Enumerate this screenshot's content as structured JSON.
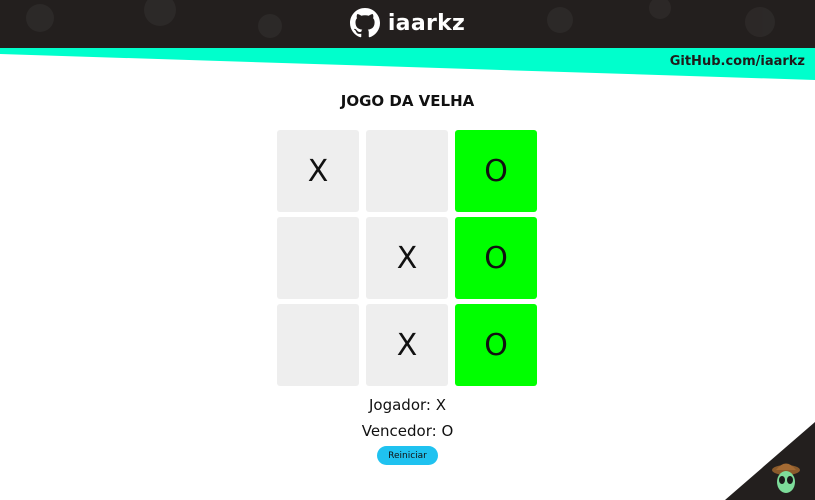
{
  "header": {
    "brand_name": "iaarkz",
    "github_link": "GitHub.com/iaarkz"
  },
  "game": {
    "title": "JOGO DA VELHA",
    "board": [
      {
        "value": "X",
        "winning": false
      },
      {
        "value": "",
        "winning": false
      },
      {
        "value": "O",
        "winning": true
      },
      {
        "value": "",
        "winning": false
      },
      {
        "value": "X",
        "winning": false
      },
      {
        "value": "O",
        "winning": true
      },
      {
        "value": "",
        "winning": false
      },
      {
        "value": "X",
        "winning": false
      },
      {
        "value": "O",
        "winning": true
      }
    ],
    "player_text": "Jogador: X",
    "winner_text": "Vencedor: O",
    "restart_label": "Reiniciar"
  },
  "colors": {
    "header_bg": "#231f1e",
    "accent": "#00ffcc",
    "cell_bg": "#eeeeee",
    "win_bg": "#00ff00",
    "button_bg": "#1fc2f0"
  },
  "icons": {
    "brand_logo": "github-icon",
    "corner": "alien-avatar-icon"
  }
}
